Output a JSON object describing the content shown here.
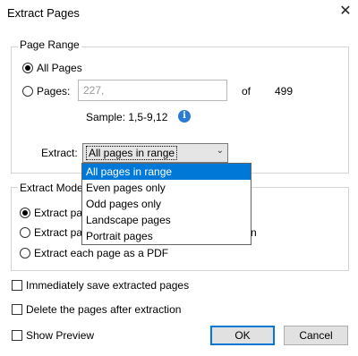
{
  "window": {
    "title": "Extract Pages"
  },
  "page_range": {
    "legend": "Page Range",
    "all_pages_label": "All Pages",
    "pages_label": "Pages:",
    "pages_placeholder": "227,",
    "of_label": "of",
    "total_pages": "499",
    "sample_text": "Sample: 1,5-9,12",
    "extract_label": "Extract:",
    "extract_selected": "All pages in range",
    "extract_options": [
      "All pages in range",
      "Even pages only",
      "Odd pages only",
      "Landscape pages",
      "Portrait pages"
    ]
  },
  "extract_mode": {
    "legend": "Extract Mode",
    "option1_visible": "Extract pa",
    "option2_visible": "Extract pa",
    "option2_tail": "n",
    "option3": "Extract each page as a PDF"
  },
  "options": {
    "save_immediately": "Immediately save extracted pages",
    "delete_after": "Delete the pages after extraction",
    "show_preview": "Show Preview"
  },
  "buttons": {
    "ok": "OK",
    "cancel": "Cancel"
  },
  "colors": {
    "selection": "#0078d7",
    "info": "#2a7bd4"
  }
}
